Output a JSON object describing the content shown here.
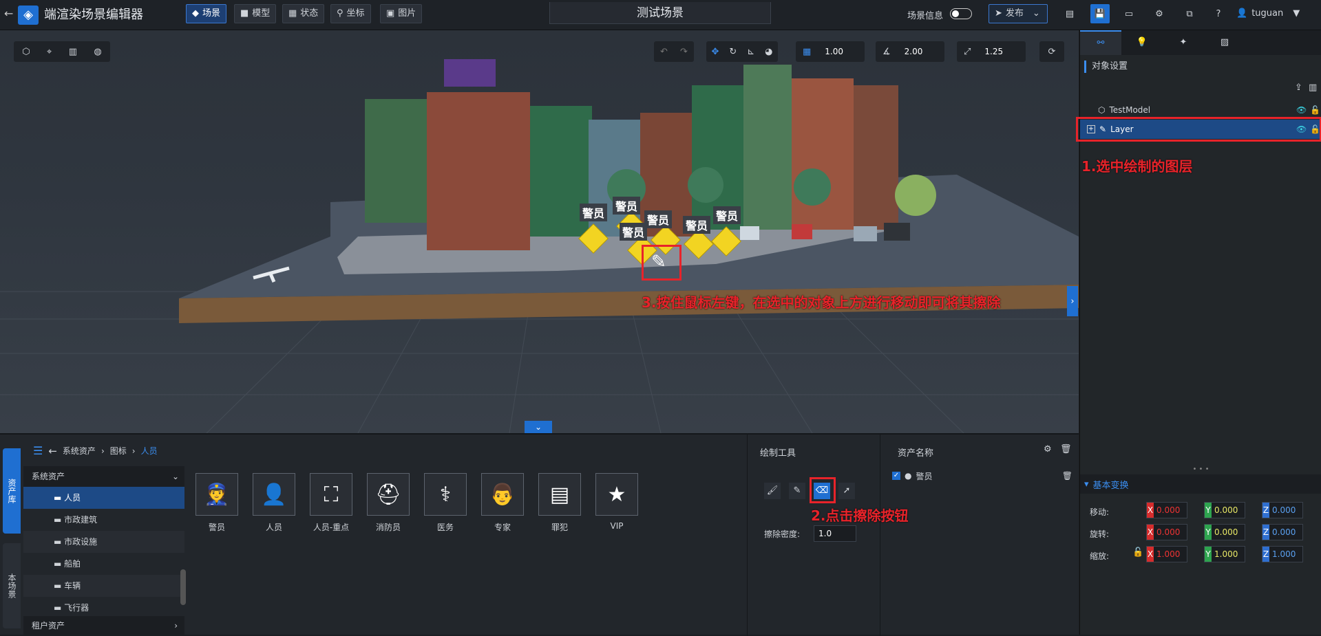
{
  "app": {
    "title": "端渲染场景编辑器",
    "scene_name": "测试场景"
  },
  "nav_tabs": [
    "场景",
    "模型",
    "状态",
    "坐标",
    "图片"
  ],
  "header": {
    "scene_info_label": "场景信息",
    "publish_label": "发布",
    "user": "tuguan"
  },
  "viewport": {
    "grid_size": "1.00",
    "angle_snap": "2.00",
    "scale_snap": "1.25",
    "labels": [
      "警员",
      "警员",
      "警员",
      "警员",
      "警员",
      "警员"
    ],
    "annotation_3": "3.按住鼠标左键，在选中的对象上方进行移动即可将其擦除"
  },
  "right_panel": {
    "section_title": "对象设置",
    "layers": [
      {
        "name": "TestModel"
      },
      {
        "name": "Layer"
      }
    ],
    "annotation_1": "1.选中绘制的图层",
    "transform_title": "基本变换",
    "move_label": "移动:",
    "rotate_label": "旋转:",
    "scale_label": "缩放:",
    "move": {
      "x": "0.000",
      "y": "0.000",
      "z": "0.000"
    },
    "rotate": {
      "x": "0.000",
      "y": "0.000",
      "z": "0.000"
    },
    "scale": {
      "x": "1.000",
      "y": "1.000",
      "z": "1.000"
    },
    "axis": {
      "x": "X",
      "y": "Y",
      "z": "Z"
    }
  },
  "library": {
    "side_tabs": [
      "资产库",
      "本场景"
    ],
    "breadcrumb": [
      "系统资产",
      "图标",
      "人员"
    ],
    "tree_header": "系统资产",
    "tree": [
      "人员",
      "市政建筑",
      "市政设施",
      "船舶",
      "车辆",
      "飞行器"
    ],
    "tenant_assets": "租户资产",
    "assets": [
      "警员",
      "人员",
      "人员-重点",
      "消防员",
      "医务",
      "专家",
      "罪犯",
      "VIP"
    ]
  },
  "draw_tools": {
    "title": "绘制工具",
    "erase_density_label": "擦除密度:",
    "erase_density": "1.0",
    "annotation_2": "2.点击擦除按钮"
  },
  "asset_list": {
    "title": "资产名称",
    "items": [
      "警员"
    ]
  },
  "colors": {
    "accent": "#1f6fd1",
    "annotation": "#e8232a",
    "selected_row": "#1d4a86"
  }
}
